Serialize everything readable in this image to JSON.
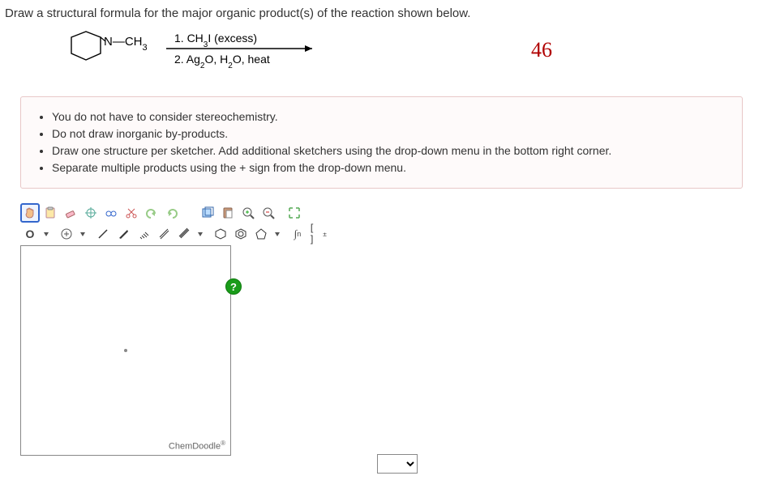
{
  "prompt": "Draw a structural formula for the major organic product(s) of the reaction shown below.",
  "reaction": {
    "reactant_label": "N—CH",
    "reactant_sub": "3",
    "reagent1": "1. CH",
    "reagent1_sub": "3",
    "reagent1_rest": "I  (excess)",
    "reagent2": "2. Ag",
    "reagent2_sub": "2",
    "reagent2_mid": "O, H",
    "reagent2_sub2": "2",
    "reagent2_end": "O, heat"
  },
  "annotation": "46",
  "instructions": [
    "You do not have to consider stereochemistry.",
    "Do not draw inorganic by-products.",
    "Draw one structure per sketcher. Add additional sketchers using the drop-down menu in the bottom right corner.",
    "Separate multiple products using the + sign from the drop-down menu."
  ],
  "atom_label": "O",
  "help_symbol": "?",
  "brand": "ChemDoodle",
  "bracket_label": "[ ]",
  "integral_n": "n"
}
